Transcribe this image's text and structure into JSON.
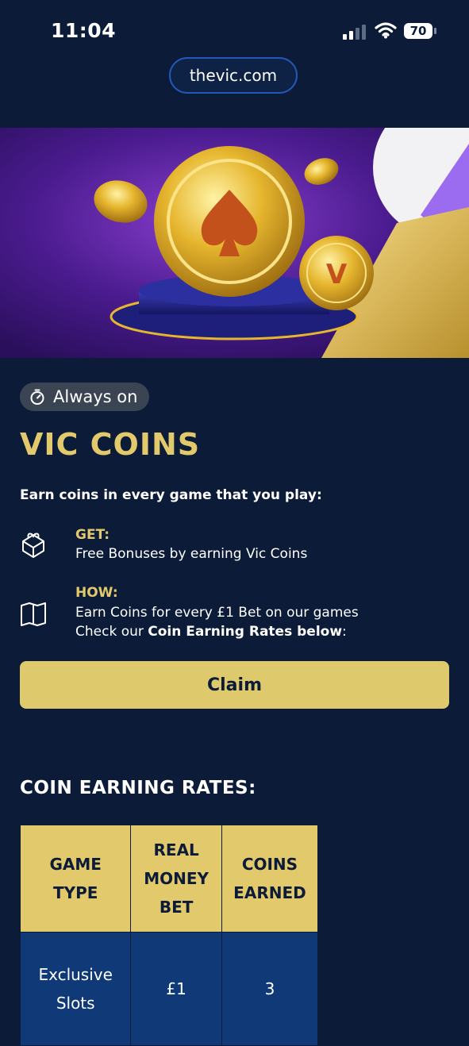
{
  "status_bar": {
    "time": "11:04",
    "battery": "70"
  },
  "browser": {
    "url": "thevic.com"
  },
  "promo": {
    "badge": "Always on",
    "title": "VIC COINS",
    "intro": "Earn coins in every game that you play:",
    "get_label": "GET:",
    "get_text": "Free Bonuses by earning Vic Coins",
    "how_label": "HOW:",
    "how_line1": "Earn Coins for every £1 Bet on our games",
    "how_line2_prefix": "Check our ",
    "how_line2_bold": "Coin Earning Rates below",
    "how_line2_suffix": ":",
    "claim_label": "Claim"
  },
  "rates": {
    "title": "COIN EARNING RATES:",
    "headers": [
      "GAME TYPE",
      "REAL MONEY BET",
      "COINS EARNED"
    ],
    "rows": [
      {
        "game_type": "Exclusive Slots",
        "bet": "£1",
        "coins": "3"
      }
    ]
  },
  "colors": {
    "background": "#0b1b38",
    "accent_gold": "#e2c96b",
    "table_cell": "#0f3a77"
  },
  "icons": [
    "signal-icon",
    "wifi-icon",
    "battery-icon",
    "stopwatch-icon",
    "gift-icon",
    "book-icon"
  ]
}
